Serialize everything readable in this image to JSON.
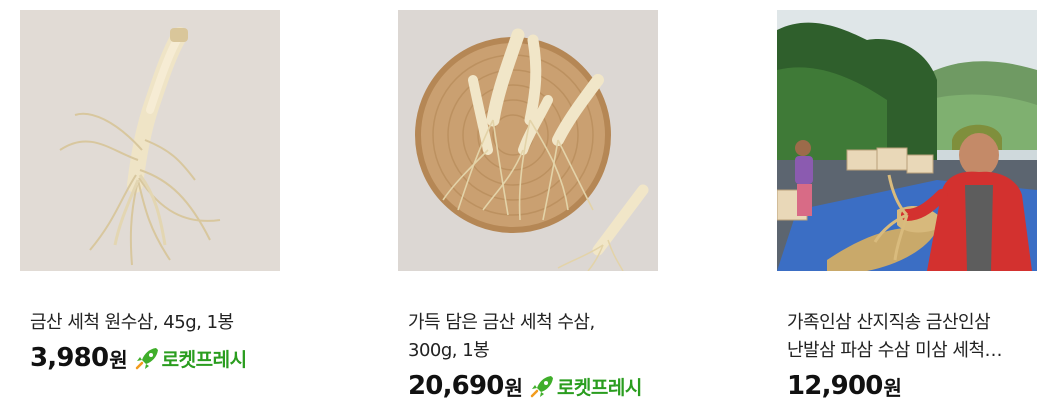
{
  "products": [
    {
      "title_lines": [
        "금산 세척 원수삼, 45g, 1봉"
      ],
      "price": "3,980",
      "currency": "원",
      "badge": "로켓프레시",
      "image": "ginseng-root-photo"
    },
    {
      "title_lines": [
        "가득 담은 금산 세척 수삼,",
        "300g, 1봉"
      ],
      "price": "20,690",
      "currency": "원",
      "badge": "로켓프레시",
      "image": "ginseng-basket-photo"
    },
    {
      "title_lines": [
        "가족인삼 산지직송 금산인삼",
        "난발삼 파삼 수삼 미삼 세척…"
      ],
      "price": "12,900",
      "currency": "원",
      "image": "ginseng-farm-photo"
    }
  ],
  "colors": {
    "badge_green": "#2a9d1f",
    "rocket_green": "#3fae2a"
  }
}
